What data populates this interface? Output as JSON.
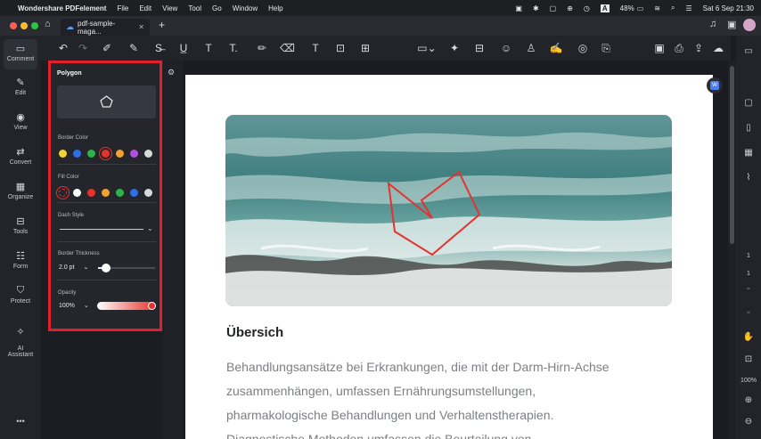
{
  "menubar": {
    "app_name": "Wondershare PDFelement",
    "menus": [
      "File",
      "Edit",
      "View",
      "Tool",
      "Go",
      "Window",
      "Help"
    ],
    "battery": "48%",
    "datetime": "Sat 6 Sep  21:30"
  },
  "tabs": [
    {
      "label": "pdf-sample-maga..."
    }
  ],
  "toolbar": {
    "icons": [
      "undo-icon",
      "redo-icon",
      "highlighter-icon",
      "area-highlight-icon",
      "strikethrough-icon",
      "underline-icon",
      "text-icon",
      "text-callout-icon",
      "pencil-icon",
      "eraser-icon",
      "typewriter-icon",
      "textbox-icon",
      "callout-box-icon",
      "shape-icon",
      "pin-icon",
      "measure-icon",
      "sticker-icon",
      "stamp-icon",
      "signature-icon",
      "eye-icon",
      "attach-icon"
    ]
  },
  "left_rail": {
    "items": [
      {
        "id": "comment",
        "label": "Comment",
        "glyph": "▭"
      },
      {
        "id": "edit",
        "label": "Edit",
        "glyph": "✎"
      },
      {
        "id": "view",
        "label": "View",
        "glyph": "◉"
      },
      {
        "id": "convert",
        "label": "Convert",
        "glyph": "⇄"
      },
      {
        "id": "organize",
        "label": "Organize",
        "glyph": "▦"
      },
      {
        "id": "tools",
        "label": "Tools",
        "glyph": "⊟"
      },
      {
        "id": "form",
        "label": "Form",
        "glyph": "☷"
      },
      {
        "id": "protect",
        "label": "Protect",
        "glyph": "⛉"
      },
      {
        "id": "ai",
        "label": "AI\nAssistant",
        "glyph": "✧"
      }
    ],
    "more": "•••"
  },
  "panel": {
    "title": "Polygon",
    "border_color_label": "Border Color",
    "border_colors": [
      "#f2d33a",
      "#2f6fe4",
      "#2db34a",
      "#e5322d",
      "#f0a331",
      "#b04fe0",
      "#d9d9d9"
    ],
    "border_selected": 3,
    "fill_color_label": "Fill Color",
    "fill_colors": [
      "none",
      "#ffffff",
      "#e5322d",
      "#f0a331",
      "#2db34a",
      "#2f6fe4",
      "#d9d9d9"
    ],
    "fill_selected": 0,
    "dash_style_label": "Dash Style",
    "border_thickness_label": "Border Thickness",
    "thickness_value": "2.0 pt",
    "thickness_fraction": 0.14,
    "opacity_label": "Opacity",
    "opacity_value": "100%",
    "opacity_fraction": 1.0
  },
  "document": {
    "heading": "Übersich",
    "body_lines": [
      "Behandlungsansätze bei Erkrankungen, die mit der Darm-Hirn-Achse",
      "zusammenhängen, umfassen Ernährungsumstellungen,",
      "pharmakologische Behandlungen und Verhaltenstherapien.",
      "Diagnostische Methoden umfassen die Beurteilung von"
    ]
  },
  "right_rail": {
    "page_current": "1",
    "page_total": "1",
    "zoom": "100%"
  },
  "colors": {
    "accent_red": "#e2202d",
    "panel_bg": "#24262c",
    "app_bg": "#1b1d22"
  }
}
